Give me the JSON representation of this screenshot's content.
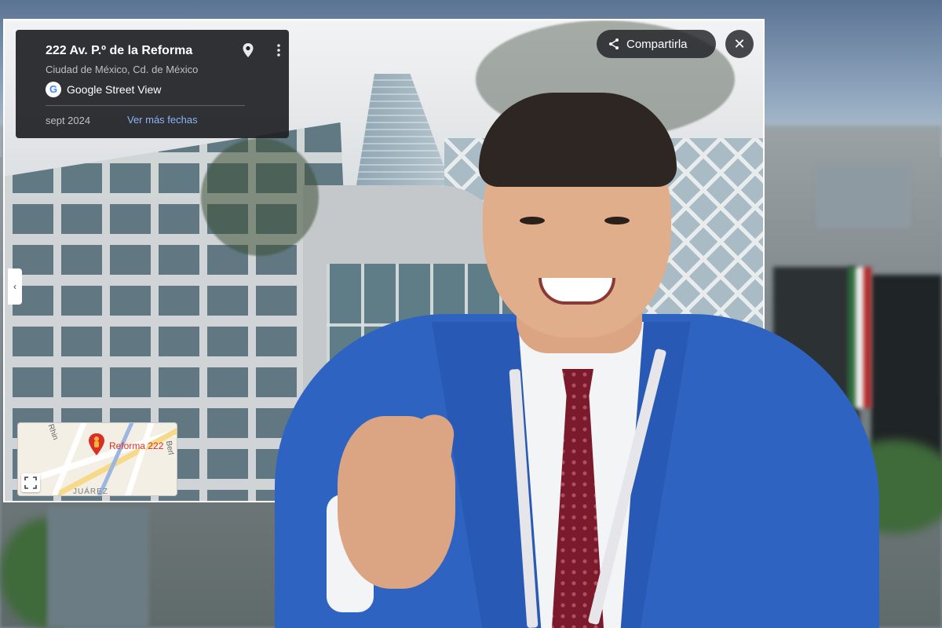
{
  "location_panel": {
    "title": "222 Av. P.º de la Reforma",
    "subtitle": "Ciudad de México, Cd. de México",
    "brand_label": "Google Street View",
    "date": "sept 2024",
    "more_dates_link": "Ver más fechas"
  },
  "controls": {
    "share_label": "Compartirla",
    "close_glyph": "✕",
    "collapse_glyph": "‹"
  },
  "mini_map": {
    "place_label": "Reforma 222",
    "street_left": "Rhin",
    "street_right": "Berl",
    "area_label": "JUÁREZ"
  },
  "icons": {
    "pin": "location-pin-icon",
    "more": "more-vert-icon",
    "google": "google-logo-icon",
    "share": "share-icon",
    "close": "close-icon",
    "expand": "fullscreen-icon"
  },
  "colors": {
    "panel_bg": "#202124",
    "link": "#8ab4f8",
    "jacket": "#2f63c2",
    "tie": "#7a1a2a",
    "pin": "#d93025"
  }
}
